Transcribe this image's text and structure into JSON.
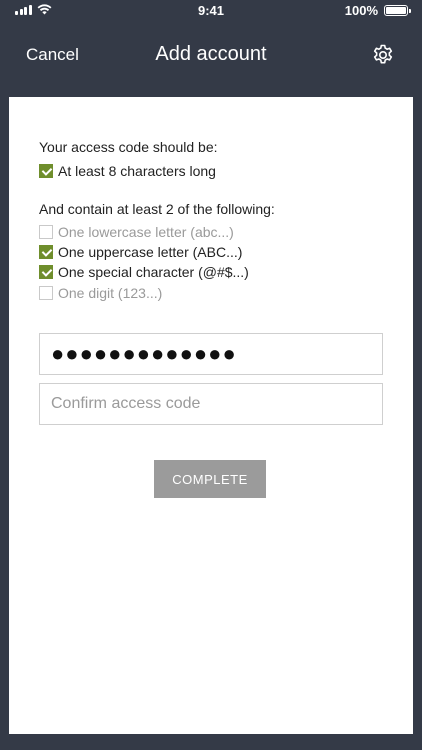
{
  "status_bar": {
    "time": "9:41",
    "battery": "100%"
  },
  "nav": {
    "cancel": "Cancel",
    "title": "Add account",
    "settings_icon": "gear-icon"
  },
  "requirements": {
    "heading": "Your access code should be:",
    "length_rule": {
      "label": "At least 8 characters long",
      "met": true
    },
    "contain_heading": "And contain at least 2 of the following:",
    "rules": [
      {
        "label": "One lowercase letter (abc...)",
        "met": false
      },
      {
        "label": "One uppercase letter (ABC...)",
        "met": true
      },
      {
        "label": "One special character (@#$...)",
        "met": true
      },
      {
        "label": "One digit (123...)",
        "met": false
      }
    ]
  },
  "form": {
    "password_value": "●●●●●●●●●●●●●",
    "confirm_placeholder": "Confirm access code",
    "confirm_value": "",
    "complete_label": "COMPLETE"
  },
  "colors": {
    "nav_bg": "#343a47",
    "check_on": "#6f8e2c",
    "button_bg": "#9b9b9b"
  }
}
